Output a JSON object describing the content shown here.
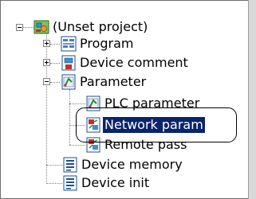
{
  "tree": {
    "root": {
      "label": "(Unset project)",
      "icon": "project-icon",
      "toggle": "minus"
    },
    "items": [
      {
        "label": "Program",
        "icon": "program-icon",
        "toggle": "plus"
      },
      {
        "label": "Device comment",
        "icon": "device-comment-icon",
        "toggle": "plus"
      },
      {
        "label": "Parameter",
        "icon": "parameter-icon",
        "toggle": "minus",
        "children": [
          {
            "label": "PLC parameter",
            "icon": "plc-parameter-icon"
          },
          {
            "label": "Network param",
            "icon": "network-param-icon",
            "selected": true
          },
          {
            "label": "Remote pass",
            "icon": "remote-pass-icon"
          }
        ]
      },
      {
        "label": "Device memory",
        "icon": "device-memory-icon"
      },
      {
        "label": "Device init",
        "icon": "device-init-icon"
      }
    ]
  },
  "colors": {
    "selection_bg": "#0a246a",
    "selection_text": "#ffffff",
    "tree_line": "#808080"
  }
}
